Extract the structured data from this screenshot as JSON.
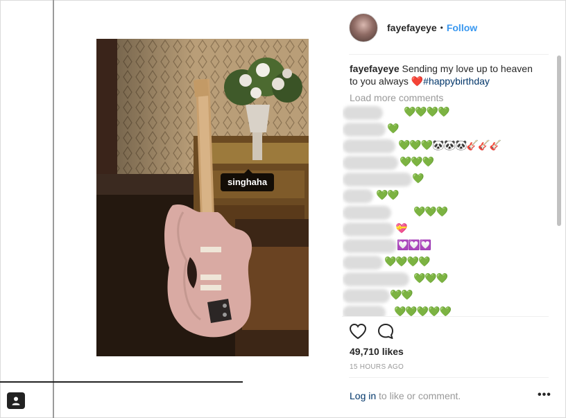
{
  "header": {
    "username": "fayefayeye",
    "separator": "•",
    "follow_label": "Follow"
  },
  "photo": {
    "tag_label": "singhaha"
  },
  "caption": {
    "username": "fayefayeye",
    "text": "Sending my love up to heaven to you always",
    "heart": "❤️",
    "hashtag": "#happybirthday"
  },
  "comments": {
    "load_more": "Load more comments",
    "rows": [
      {
        "emoji": "💚💚💚💚"
      },
      {
        "emoji": "💚"
      },
      {
        "emoji": "💚💚💚🐼🐼🐼🎸🎸🎸"
      },
      {
        "emoji": "💚💚💚"
      },
      {
        "emoji": "💚"
      },
      {
        "emoji": "💚💚"
      },
      {
        "emoji": "💚💚💚"
      },
      {
        "emoji": "💝"
      },
      {
        "emoji": "💟💟💟"
      },
      {
        "emoji": "💚💚💚💚"
      },
      {
        "emoji": "💚💚💚"
      },
      {
        "emoji": "💚💚"
      },
      {
        "emoji": "💚💚💚💚💚"
      }
    ]
  },
  "stats": {
    "likes": "49,710 likes",
    "time": "15 HOURS AGO"
  },
  "footer": {
    "login_link": "Log in",
    "login_rest": " to like or comment.",
    "more": "•••"
  },
  "colors": {
    "follow": "#3897f0",
    "hashtag": "#003569",
    "muted": "#999999",
    "text": "#262626"
  }
}
